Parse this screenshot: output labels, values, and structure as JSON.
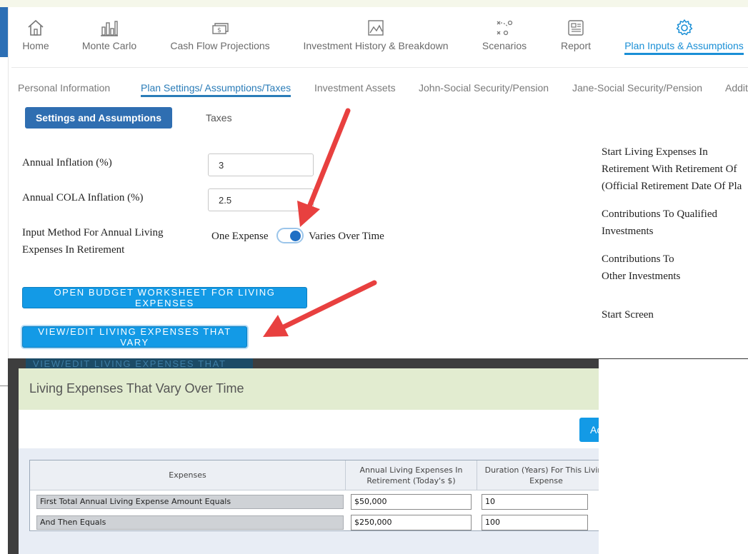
{
  "nav": {
    "items": [
      {
        "label": "Home",
        "icon": "home-icon"
      },
      {
        "label": "Monte Carlo",
        "icon": "bar-chart-icon"
      },
      {
        "label": "Cash Flow Projections",
        "icon": "cash-icon"
      },
      {
        "label": "Investment History & Breakdown",
        "icon": "image-chart-icon"
      },
      {
        "label": "Scenarios",
        "icon": "scenario-play-icon"
      },
      {
        "label": "Report",
        "icon": "report-icon"
      },
      {
        "label": "Plan Inputs & Assumptions",
        "icon": "gear-icon"
      }
    ],
    "active": "Plan Inputs & Assumptions"
  },
  "subtabs": [
    "Personal Information",
    "Plan Settings/ Assumptions/Taxes",
    "Investment Assets",
    "John-Social Security/Pension",
    "Jane-Social Security/Pension",
    "Addit"
  ],
  "section_tabs": {
    "settings": "Settings and Assumptions",
    "taxes": "Taxes"
  },
  "form": {
    "inflation_label": "Annual Inflation (%)",
    "inflation_value": "3",
    "cola_label": "Annual COLA Inflation (%)",
    "cola_value": "2.5",
    "input_method_label_1": "Input Method For Annual Living",
    "input_method_label_2": "Expenses In Retirement",
    "toggle_left": "One Expense",
    "toggle_right": "Varies Over Time",
    "budget_button": "OPEN BUDGET WORKSHEET FOR LIVING EXPENSES",
    "vary_button": "VIEW/EDIT LIVING EXPENSES THAT VARY"
  },
  "right_panel": {
    "start_1": "Start Living Expenses In",
    "start_2": "Retirement With Retirement Of",
    "start_3": "(Official Retirement Date Of Pla",
    "qual_1": "Contributions To Qualified",
    "qual_2": "Investments",
    "other_1": "Contributions To",
    "other_2": "Other Investments",
    "start_screen": "Start Screen"
  },
  "dialog": {
    "ghost_button": "VIEW/EDIT LIVING EXPENSES THAT VARY",
    "title": "Living Expenses That Vary Over Time",
    "add_button": "Ac",
    "columns": {
      "expenses": "Expenses",
      "amount": "Annual Living Expenses In Retirement (Today's $)",
      "duration": "Duration (Years) For This Living Expense"
    },
    "rows": [
      {
        "label": "First Total Annual Living Expense Amount Equals",
        "amount": "$50,000",
        "duration": "10"
      },
      {
        "label": "And Then Equals",
        "amount": "$250,000",
        "duration": "100"
      }
    ]
  },
  "colors": {
    "accent": "#1a8fd6",
    "primary_button": "#2f6eb1",
    "action_button": "#139ae6",
    "annotation_arrow": "#e8403f"
  }
}
